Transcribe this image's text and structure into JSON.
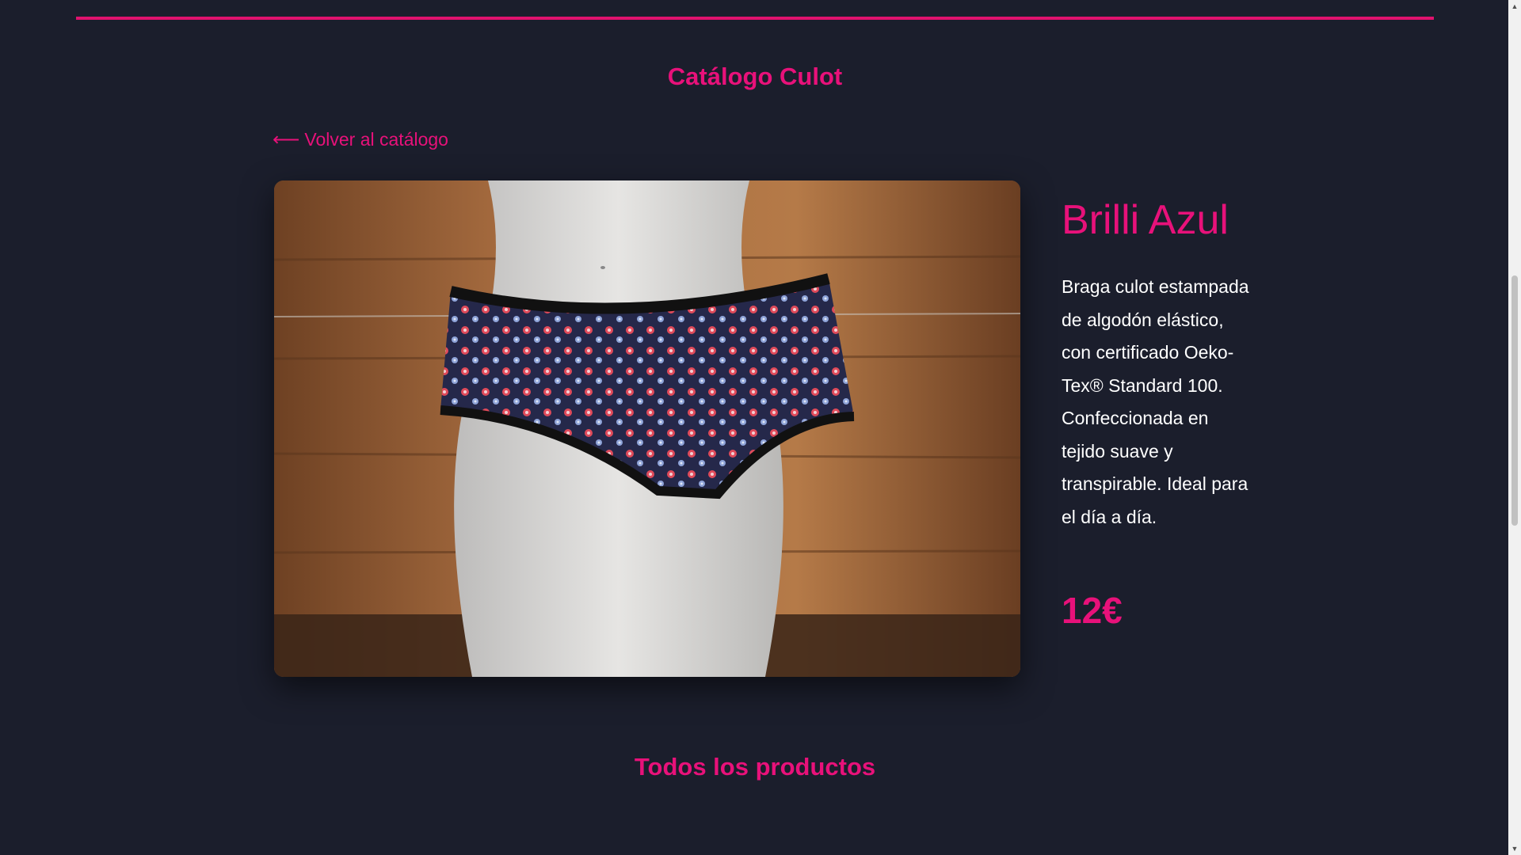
{
  "header": {
    "catalog_title": "Catálogo Culot",
    "accent_color": "#e8117a"
  },
  "navigation": {
    "back_arrow": "⟵",
    "back_label": "Volver al catálogo"
  },
  "product": {
    "name": "Brilli Azul",
    "description": "Braga culot estampada de algodón elástico, con certificado Oeko-Tex® Standard 100. Confeccionada en tejido suave y transpirable. Ideal para el día a día.",
    "price": "12€",
    "image_icon": "product-photo"
  },
  "sections": {
    "all_products_title": "Todos los productos"
  },
  "colors": {
    "background": "#1b1e2c",
    "accent": "#e8117a",
    "text": "#ffffff"
  }
}
